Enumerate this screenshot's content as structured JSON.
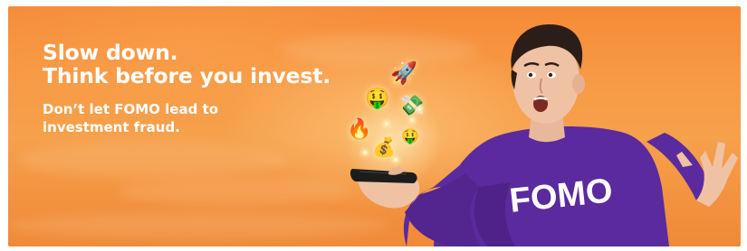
{
  "banner": {
    "headline_line1": "Slow down.",
    "headline_line2": "Think before you invest.",
    "subline_line1": "Don’t let FOMO lead to",
    "subline_line2": "investment fraud.",
    "shirt_text": "FOMO"
  },
  "colors": {
    "background": "#f79a45",
    "text": "#ffffff",
    "shirt": "#5b2a9e"
  },
  "icons": [
    "rocket-icon",
    "money-face-icon",
    "money-with-wings-icon",
    "fire-icon",
    "money-bag-icon",
    "sparkle-icon"
  ]
}
